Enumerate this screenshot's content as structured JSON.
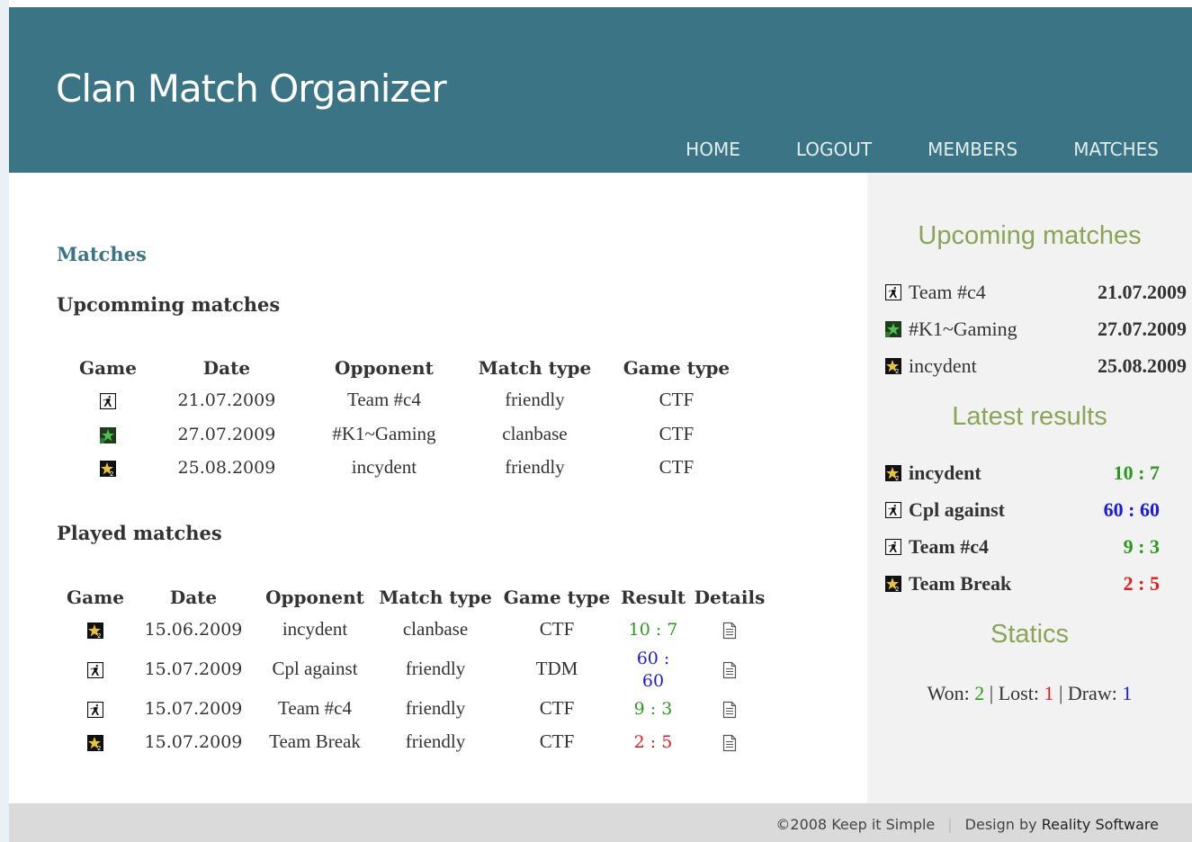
{
  "header": {
    "title": "Clan Match Organizer",
    "nav": [
      "HOME",
      "LOGOUT",
      "MEMBERS",
      "MATCHES"
    ]
  },
  "main": {
    "heading": "Matches",
    "upcoming": {
      "title": "Upcomming matches",
      "columns": [
        "Game",
        "Date",
        "Opponent",
        "Match type",
        "Game type"
      ],
      "rows": [
        {
          "game_icon": "cs-icon",
          "date": "21.07.2009",
          "opponent": "Team #c4",
          "match_type": "friendly",
          "game_type": "CTF"
        },
        {
          "game_icon": "star-green-icon",
          "date": "27.07.2009",
          "opponent": "#K1~Gaming",
          "match_type": "clanbase",
          "game_type": "CTF"
        },
        {
          "game_icon": "star-gold-icon",
          "date": "25.08.2009",
          "opponent": "incydent",
          "match_type": "friendly",
          "game_type": "CTF"
        }
      ]
    },
    "played": {
      "title": "Played matches",
      "columns": [
        "Game",
        "Date",
        "Opponent",
        "Match type",
        "Game type",
        "Result",
        "Details"
      ],
      "rows": [
        {
          "game_icon": "star-gold-icon",
          "date": "15.06.2009",
          "opponent": "incydent",
          "match_type": "clanbase",
          "game_type": "CTF",
          "result": "10 : 7",
          "result_color": "#2a9a1a"
        },
        {
          "game_icon": "cs-icon",
          "date": "15.07.2009",
          "opponent": "Cpl against",
          "match_type": "friendly",
          "game_type": "TDM",
          "result": "60 : 60",
          "result_color": "#1a1ae6"
        },
        {
          "game_icon": "cs-icon",
          "date": "15.07.2009",
          "opponent": "Team #c4",
          "match_type": "friendly",
          "game_type": "CTF",
          "result": "9 : 3",
          "result_color": "#2a9a1a"
        },
        {
          "game_icon": "star-gold-icon",
          "date": "15.07.2009",
          "opponent": "Team Break",
          "match_type": "friendly",
          "game_type": "CTF",
          "result": "2 : 5",
          "result_color": "#e61a1a"
        }
      ]
    }
  },
  "sidebar": {
    "upcoming_title": "Upcoming matches",
    "upcoming": [
      {
        "game_icon": "cs-icon",
        "name": "Team #c4",
        "date": "21.07.2009"
      },
      {
        "game_icon": "star-green-icon",
        "name": "#K1~Gaming",
        "date": "27.07.2009"
      },
      {
        "game_icon": "star-gold-icon",
        "name": "incydent",
        "date": "25.08.2009"
      }
    ],
    "results_title": "Latest results",
    "results": [
      {
        "game_icon": "star-gold-icon",
        "name": "incydent",
        "score": "10 : 7",
        "color": "#2a9a1a"
      },
      {
        "game_icon": "cs-icon",
        "name": "Cpl against",
        "score": "60 : 60",
        "color": "#1a1ae6"
      },
      {
        "game_icon": "cs-icon",
        "name": "Team #c4",
        "score": "9 : 3",
        "color": "#2a9a1a"
      },
      {
        "game_icon": "star-gold-icon",
        "name": "Team Break",
        "score": "2 : 5",
        "color": "#e61a1a"
      }
    ],
    "stats_title": "Statics",
    "stats": {
      "won_label": "Won: ",
      "won": "2",
      "lost_label": "Lost: ",
      "lost": "1",
      "draw_label": "Draw: ",
      "draw": "1",
      "won_color": "#2a9a1a",
      "lost_color": "#e61a1a",
      "draw_color": "#1a1ae6"
    }
  },
  "footer": {
    "copyright": "©2008 Keep it Simple",
    "design_prefix": "Design by ",
    "design_link": "Reality Software"
  }
}
